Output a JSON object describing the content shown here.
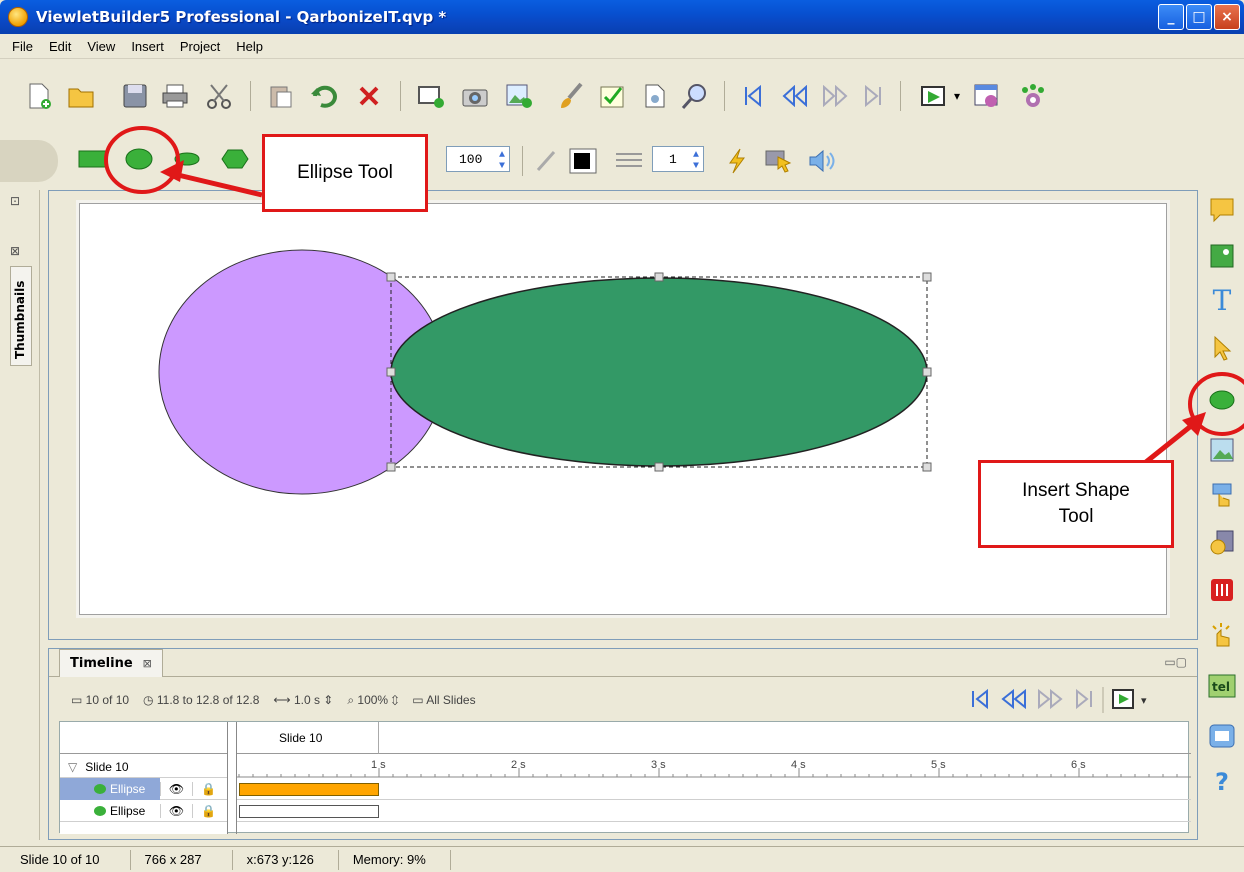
{
  "window": {
    "title": "ViewletBuilder5 Professional - QarbonizeIT.qvp *",
    "buttons": {
      "minimize": "_",
      "maximize": "□",
      "close": "×"
    }
  },
  "menu": [
    "File",
    "Edit",
    "View",
    "Insert",
    "Project",
    "Help"
  ],
  "toolbar2": {
    "opacity_value": "100",
    "line_width_value": "1"
  },
  "left_panel": {
    "tab_label": "Thumbnails"
  },
  "callouts": {
    "ellipse_tool": "Ellipse Tool",
    "insert_shape_tool": "Insert Shape Tool"
  },
  "timeline": {
    "tab_label": "Timeline",
    "info": {
      "slide_count": "10 of 10",
      "time_range": "11.8 to 12.8 of 12.8",
      "duration": "1.0 s",
      "zoom": "100%",
      "all_slides": "All Slides"
    },
    "header_slide": "Slide 10",
    "rows": [
      {
        "label": "Slide 10",
        "type": "slide"
      },
      {
        "label": "Ellipse",
        "type": "object",
        "selected": true
      },
      {
        "label": "Ellipse",
        "type": "object",
        "selected": false
      }
    ],
    "ruler_labels": [
      "1 s",
      "2 s",
      "3 s",
      "4 s",
      "5 s",
      "6 s"
    ]
  },
  "status": {
    "slide": "Slide 10 of 10",
    "size": "766 x 287",
    "cursor": "x:673 y:126",
    "memory": "Memory: 9%"
  },
  "colors": {
    "purple_ellipse": "#cc99ff",
    "green_ellipse": "#339966",
    "callout_border": "#e01818",
    "timeline_bar_selected": "#ffa500"
  }
}
